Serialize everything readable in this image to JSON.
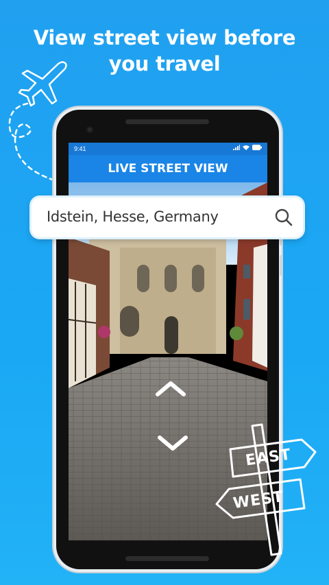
{
  "headline": {
    "line1": "View street view before",
    "line2": "you travel"
  },
  "status_bar": {
    "time": "9:41"
  },
  "app_bar": {
    "title": "LIVE STREET VIEW"
  },
  "search": {
    "value": "Idstein, Hesse, Germany"
  },
  "signpost": {
    "east": "EAST",
    "west": "WEST"
  },
  "colors": {
    "background": "#1aa8f4",
    "app_bar": "#1a85e6",
    "status_bar": "#1878d6"
  }
}
